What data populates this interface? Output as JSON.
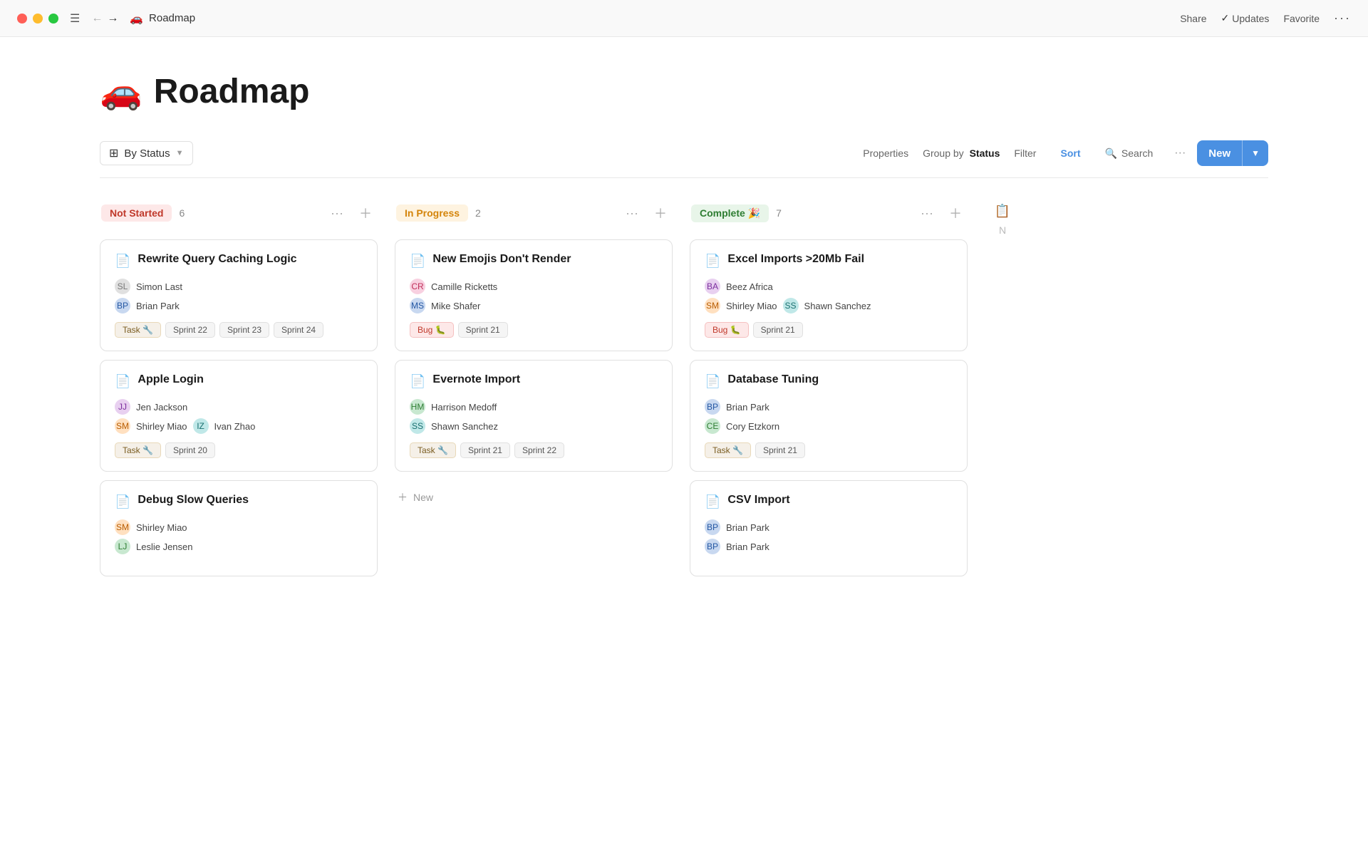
{
  "titlebar": {
    "page_title": "Roadmap",
    "page_emoji": "🚗",
    "share_label": "Share",
    "updates_label": "Updates",
    "favorite_label": "Favorite"
  },
  "toolbar": {
    "by_status_label": "By Status",
    "properties_label": "Properties",
    "group_by_label": "Group by",
    "group_by_value": "Status",
    "filter_label": "Filter",
    "sort_label": "Sort",
    "search_label": "Search",
    "more_label": "···",
    "new_label": "New"
  },
  "columns": [
    {
      "id": "not-started",
      "status": "Not Started",
      "count": 6,
      "status_class": "status-not-started",
      "cards": [
        {
          "title": "Rewrite Query Caching Logic",
          "assignees": [
            "Simon Last",
            "Brian Park"
          ],
          "tags": [
            "Task 🔧"
          ],
          "sprints": [
            "Sprint 22",
            "Sprint 23",
            "Sprint 24"
          ],
          "tag_type": "task"
        },
        {
          "title": "Apple Login",
          "assignees": [
            "Jen Jackson",
            "Shirley Miao",
            "Ivan Zhao"
          ],
          "tags": [
            "Task 🔧"
          ],
          "sprints": [
            "Sprint 20"
          ],
          "tag_type": "task"
        },
        {
          "title": "Debug Slow Queries",
          "assignees": [
            "Shirley Miao",
            "Leslie Jensen"
          ],
          "tags": [],
          "sprints": [],
          "tag_type": "none"
        }
      ]
    },
    {
      "id": "in-progress",
      "status": "In Progress",
      "count": 2,
      "status_class": "status-in-progress",
      "cards": [
        {
          "title": "New Emojis Don't Render",
          "assignees": [
            "Camille Ricketts",
            "Mike Shafer"
          ],
          "tags": [
            "Bug 🐛"
          ],
          "sprints": [
            "Sprint 21"
          ],
          "tag_type": "bug"
        },
        {
          "title": "Evernote Import",
          "assignees": [
            "Harrison Medoff",
            "Shawn Sanchez"
          ],
          "tags": [
            "Task 🔧"
          ],
          "sprints": [
            "Sprint 21",
            "Sprint 22"
          ],
          "tag_type": "task"
        }
      ],
      "show_new": true,
      "new_label": "+ New"
    },
    {
      "id": "complete",
      "status": "Complete 🎉",
      "count": 7,
      "status_class": "status-complete",
      "cards": [
        {
          "title": "Excel Imports >20Mb Fail",
          "assignees": [
            "Beez Africa",
            "Shirley Miao",
            "Shawn Sanchez"
          ],
          "tags": [
            "Bug 🐛"
          ],
          "sprints": [
            "Sprint 21"
          ],
          "tag_type": "bug"
        },
        {
          "title": "Database Tuning",
          "assignees": [
            "Brian Park",
            "Cory Etzkorn"
          ],
          "tags": [
            "Task 🔧"
          ],
          "sprints": [
            "Sprint 21"
          ],
          "tag_type": "task"
        },
        {
          "title": "CSV Import",
          "assignees": [
            "Brian Park",
            "Brian Park"
          ],
          "tags": [],
          "sprints": [],
          "tag_type": "none"
        }
      ]
    }
  ],
  "hidden_column": {
    "label": "N"
  }
}
